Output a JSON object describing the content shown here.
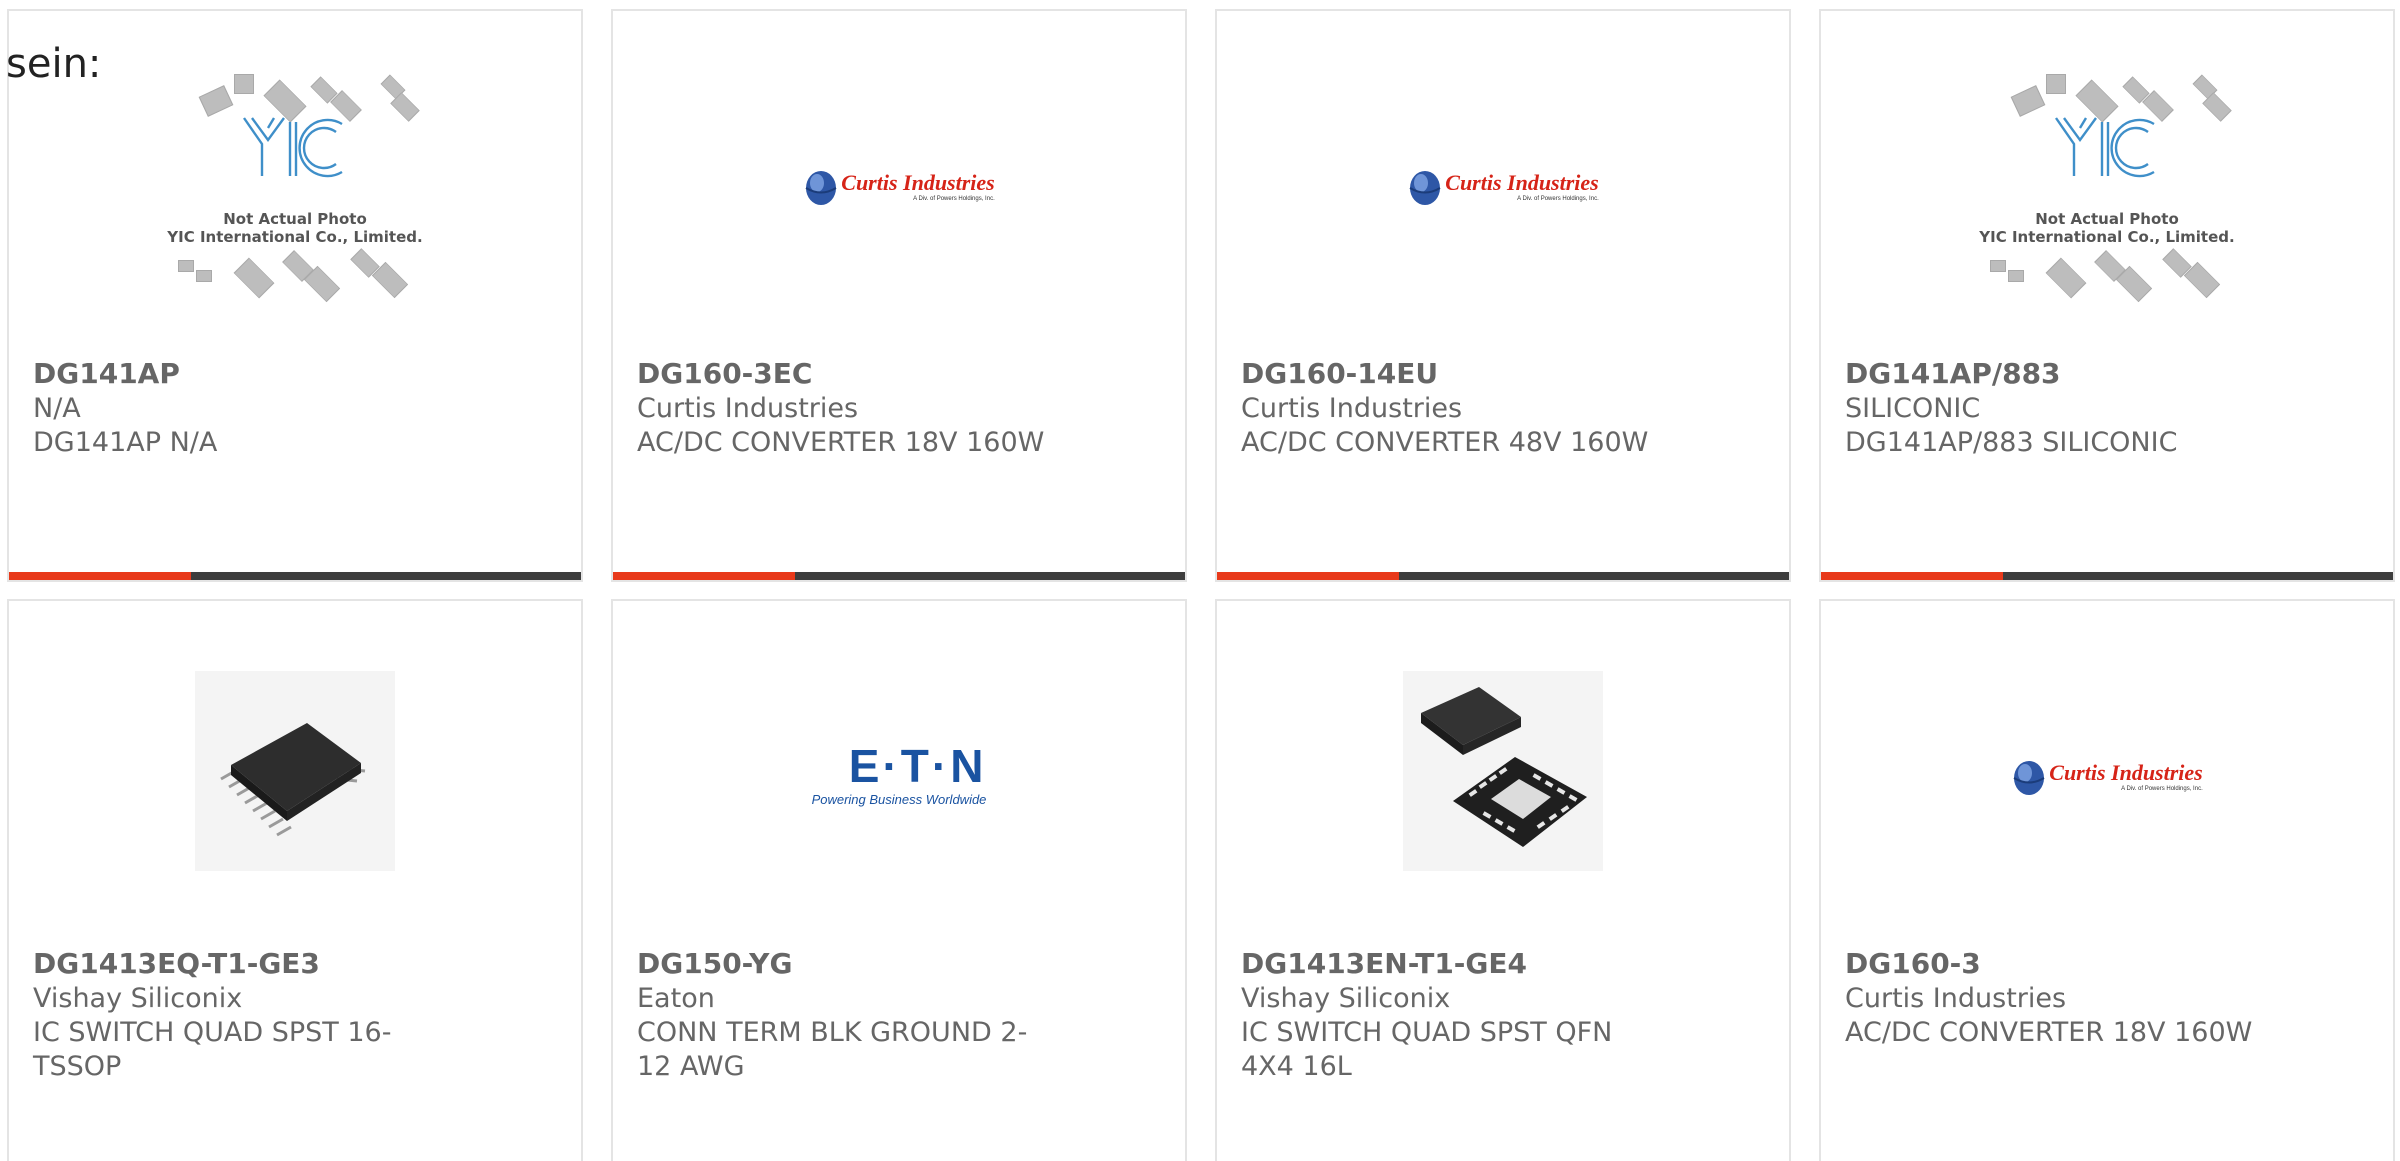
{
  "lead_text": "sein:",
  "colors": {
    "accent_bar": "#e8391a",
    "dark_bar": "#3d3d3d",
    "card_text": "#666666",
    "card_border": "#e4e4e4"
  },
  "cards": [
    {
      "image": "yic-not-actual-photo",
      "part": "DG141AP",
      "manufacturer": "N/A",
      "description": "DG141AP N/A",
      "has_bar": true
    },
    {
      "image": "curtis-industries-logo",
      "part": "DG160-3EC",
      "manufacturer": "Curtis Industries",
      "description": "AC/DC CONVERTER 18V 160W",
      "has_bar": true
    },
    {
      "image": "curtis-industries-logo",
      "part": "DG160-14EU",
      "manufacturer": "Curtis Industries",
      "description": "AC/DC CONVERTER 48V 160W",
      "has_bar": true
    },
    {
      "image": "yic-not-actual-photo",
      "part": "DG141AP/883",
      "manufacturer": "SILICONIC",
      "description": "DG141AP/883 SILICONIC",
      "has_bar": true
    },
    {
      "image": "tssop-chip-photo",
      "part": "DG1413EQ-T1-GE3",
      "manufacturer": "Vishay Siliconix",
      "description": "IC SWITCH QUAD SPST 16-TSSOP",
      "has_bar": false
    },
    {
      "image": "eaton-logo",
      "part": "DG150-YG",
      "manufacturer": "Eaton",
      "description": "CONN TERM BLK GROUND 2-12 AWG",
      "has_bar": false
    },
    {
      "image": "qfn-chip-photo",
      "part": "DG1413EN-T1-GE4",
      "manufacturer": "Vishay Siliconix",
      "description": "IC SWITCH QUAD SPST QFN 4X4 16L",
      "has_bar": false
    },
    {
      "image": "curtis-industries-logo",
      "part": "DG160-3",
      "manufacturer": "Curtis Industries",
      "description": "AC/DC CONVERTER 18V 160W",
      "has_bar": false
    }
  ],
  "yic": {
    "caption_line1": "Not Actual Photo",
    "caption_line2": "YIC International Co., Limited."
  },
  "curtis": {
    "name": "Curtis Industries",
    "sub": "A Div. of Powers Holdings, Inc."
  },
  "eaton": {
    "name": "E·T·N",
    "tagline": "Powering Business Worldwide"
  }
}
